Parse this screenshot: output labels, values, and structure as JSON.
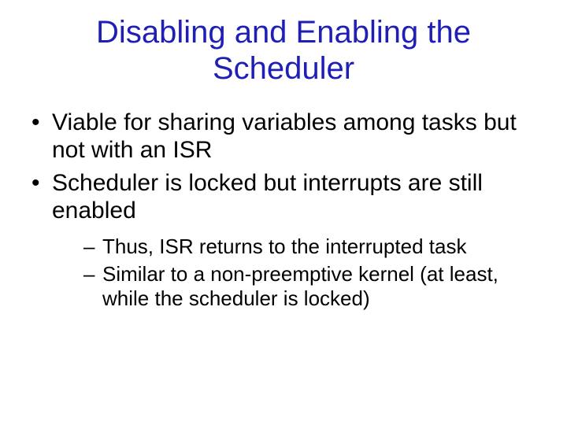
{
  "title": "Disabling and Enabling the Scheduler",
  "bullets": [
    {
      "text": "Viable for sharing variables among tasks but not with an ISR"
    },
    {
      "text": "Scheduler is locked but interrupts are still enabled",
      "sub": [
        "Thus, ISR returns to the interrupted task",
        "Similar to a non-preemptive kernel (at least, while the scheduler is locked)"
      ]
    }
  ]
}
